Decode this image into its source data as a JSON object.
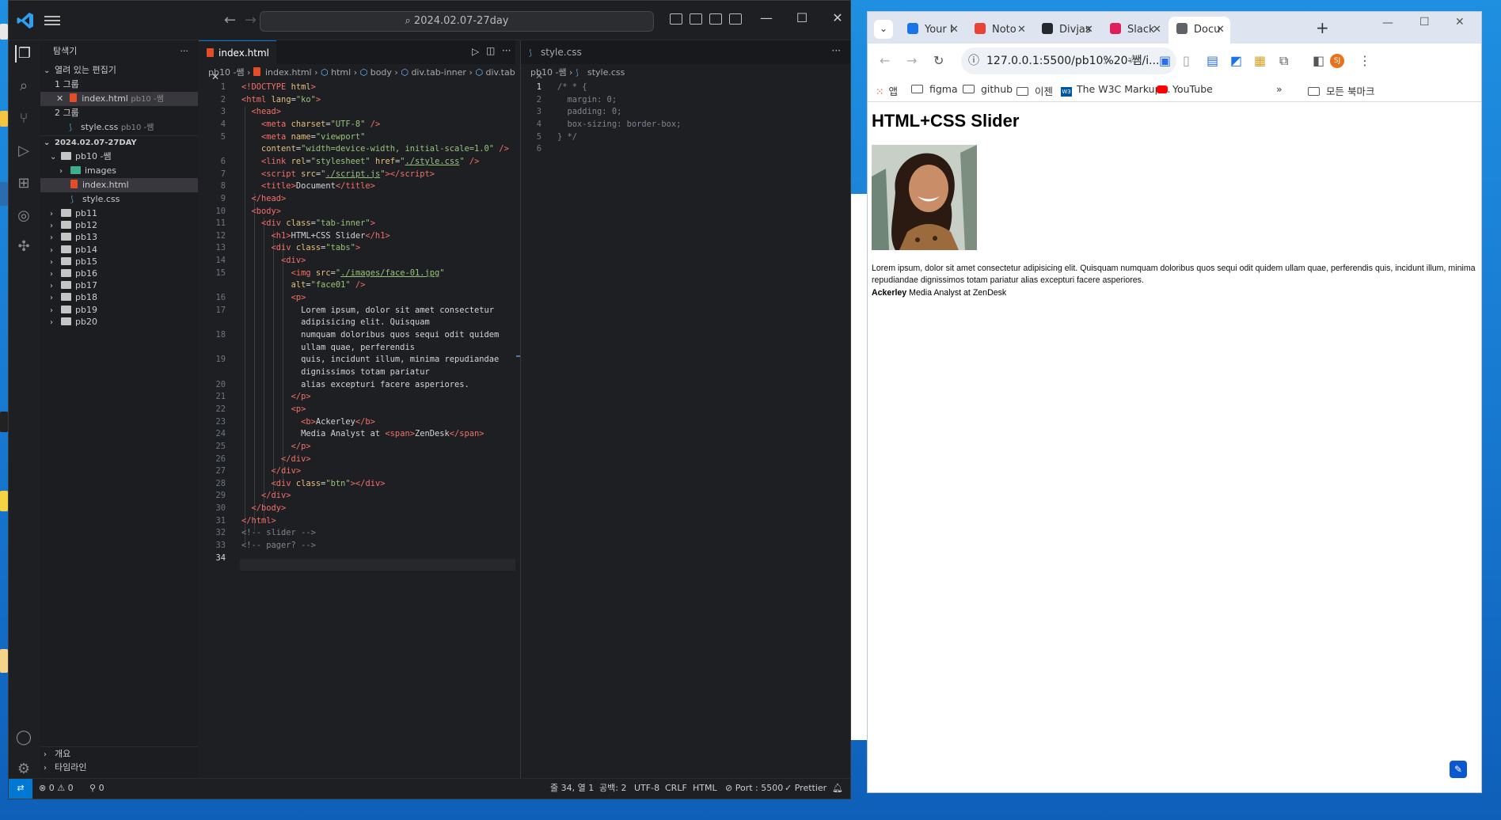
{
  "vscode": {
    "search_text": "2024.02.07-27day",
    "explorer": {
      "title": "탐색기",
      "open_editors_label": "열려 있는 편집기",
      "group1_label": "1 그룹",
      "group1_file": "index.html",
      "group1_file_dir": "pb10 -쌤",
      "group2_label": "2 그룹",
      "group2_file": "style.css",
      "group2_file_dir": "pb10 -쌤",
      "workspace_label": "2024.02.07-27DAY",
      "root_folder": "pb10 -쌤",
      "images_folder": "images",
      "index_file": "index.html",
      "style_file": "style.css",
      "folders": [
        "pb11",
        "pb12",
        "pb13",
        "pb14",
        "pb15",
        "pb16",
        "pb17",
        "pb18",
        "pb19",
        "pb20"
      ],
      "outline_label": "개요",
      "timeline_label": "타임라인"
    },
    "editor1": {
      "tab_label": "index.html",
      "breadcrumb": [
        "pb10 -쌤",
        "index.html",
        "html",
        "body",
        "div.tab-inner",
        "div.tabs"
      ]
    },
    "editor2": {
      "tab_label": "style.css",
      "breadcrumb": [
        "pb10 -쌤",
        "style.css"
      ]
    },
    "status": {
      "errors": "0",
      "warnings": "0",
      "ports": "0",
      "position": "줄 34, 열 1",
      "spaces": "공백: 2",
      "encoding": "UTF-8",
      "eol": "CRLF",
      "language": "HTML",
      "port": "Port : 5500",
      "formatter": "Prettier"
    }
  },
  "chrome": {
    "tabs": [
      {
        "label": "Your I",
        "fav": "#1a73e8"
      },
      {
        "label": "Noto",
        "fav": "#ea4335"
      },
      {
        "label": "Divjas",
        "fav": "#24292f"
      },
      {
        "label": "Slack",
        "fav": "#e01e5a"
      },
      {
        "label": "Docu",
        "fav": "#5f6368"
      }
    ],
    "new_tab": "+",
    "url": "127.0.0.1:5500/pb10%20-쌤/i...",
    "profile": "SJ",
    "bookmarks": [
      "앱",
      "figma",
      "github",
      "이젠",
      "The W3C Markup...",
      "YouTube"
    ],
    "all_bookmarks": "모든 북마크",
    "page": {
      "heading": "HTML+CSS Slider",
      "paragraph": "Lorem ipsum, dolor sit amet consectetur adipisicing elit. Quisquam numquam doloribus quos sequi odit quidem ullam quae, perferendis quis, incidunt illum, minima repudiandae dignissimos totam pariatur alias excepturi facere asperiores.",
      "author": "Ackerley",
      "role": "Media Analyst at ZenDesk"
    }
  }
}
